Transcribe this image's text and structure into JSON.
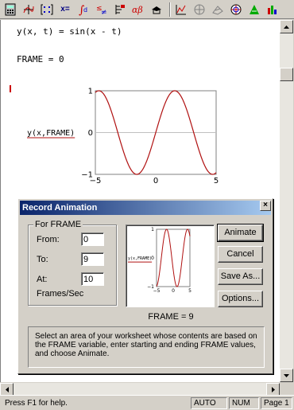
{
  "toolbar": {
    "buttons": [
      "calculator-icon",
      "graph-icon",
      "matrix-icon",
      "evaluation-icon",
      "calculus-icon",
      "boolean-icon",
      "programming-icon",
      "greek-icon",
      "symbolic-icon",
      "xy-plot-icon",
      "polar-plot-icon",
      "surface-plot-icon",
      "contour-plot-icon",
      "scatter-plot-icon",
      "bar-plot-icon"
    ],
    "eval_label": "x="
  },
  "worksheet": {
    "equation": "y(x, t) = sin(x - t)",
    "frame_line": "FRAME = 0",
    "plot": {
      "ylabel": "y(x,FRAME)",
      "y_ticks": [
        "1",
        "0",
        "−1"
      ],
      "x_ticks": [
        "−5",
        "0",
        "5"
      ],
      "curve_color": "#b01010",
      "ylim": [
        -1,
        1
      ],
      "xlim": [
        -5,
        5
      ]
    }
  },
  "dialog": {
    "title": "Record Animation",
    "close_label": "×",
    "group_label": "For FRAME",
    "from_label": "From:",
    "from_value": "0",
    "to_label": "To:",
    "to_value": "9",
    "at_label": "At:",
    "at_value": "10",
    "fps_label": "Frames/Sec",
    "preview_ylabel": "y(x,FRAME)",
    "frame_caption": "FRAME = 9",
    "buttons": {
      "animate": "Animate",
      "cancel": "Cancel",
      "save_as": "Save As...",
      "options": "Options..."
    },
    "help_text": "Select an area of your worksheet whose contents are based on the FRAME variable, enter starting and ending FRAME values, and choose Animate."
  },
  "statusbar": {
    "help": "Press F1 for help.",
    "auto": "AUTO",
    "num": "NUM",
    "page": "Page 1"
  },
  "colors": {
    "title_bar_start": "#0a246a",
    "title_bar_end": "#a6caf0",
    "curve": "#b01010"
  }
}
